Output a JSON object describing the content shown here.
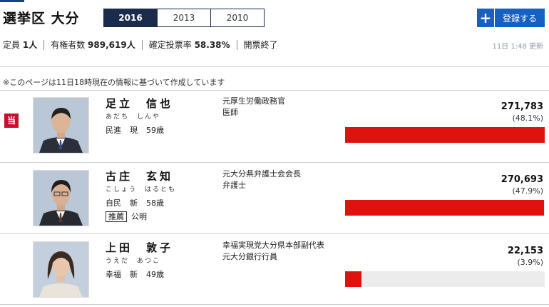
{
  "header": {
    "title": "選挙区 大分",
    "years": [
      "2016",
      "2013",
      "2010"
    ],
    "active_year": "2016",
    "register_label": "登録する"
  },
  "stats": {
    "seats_label": "定員",
    "seats_value": "1人",
    "electorate_label": "有権者数",
    "electorate_value": "989,619人",
    "turnout_label": "確定投票率",
    "turnout_value": "58.38%",
    "status": "開票終了",
    "updated": "11日 1:48 更新"
  },
  "note": "※このページは11日18時現在の情報に基づいて作成しています",
  "colors": {
    "accent": "#1560c0",
    "bar": "#e0120f",
    "winner_badge": "#c8102e",
    "tab_active": "#1b2b4b"
  },
  "candidates": [
    {
      "winner_badge": "当",
      "name": "足立　信也",
      "kana": "あだち　しんや",
      "party": "民進",
      "status": "現",
      "age": "59歳",
      "career": [
        "元厚生労働政務官",
        "医師"
      ],
      "votes": "271,783",
      "percent": "(48.1%)",
      "bar_fraction": 1.0
    },
    {
      "name": "古庄　玄知",
      "kana": "こしょう　はるとも",
      "party": "自民",
      "status": "新",
      "age": "58歳",
      "endorse_tag": "推薦",
      "endorse_party": "公明",
      "career": [
        "元大分県弁護士会会長",
        "弁護士"
      ],
      "votes": "270,693",
      "percent": "(47.9%)",
      "bar_fraction": 0.996
    },
    {
      "name": "上田　敦子",
      "kana": "うえだ　あつこ",
      "party": "幸福",
      "status": "新",
      "age": "49歳",
      "career": [
        "幸福実現党大分県本部副代表",
        "元大分銀行行員"
      ],
      "votes": "22,153",
      "percent": "(3.9%)",
      "bar_fraction": 0.0815
    }
  ]
}
